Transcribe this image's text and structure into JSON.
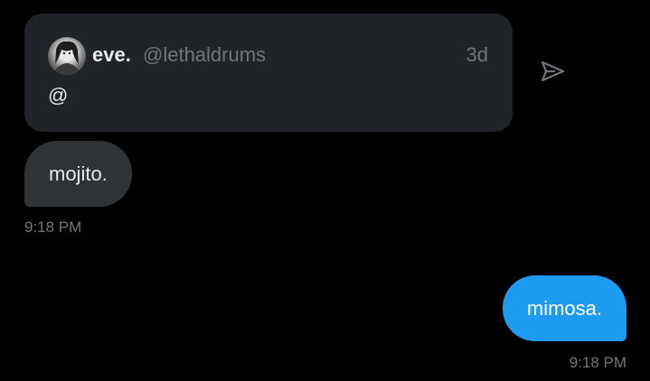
{
  "quoted_post": {
    "author_name": "eve.",
    "author_handle": "@lethaldrums",
    "age": "3d",
    "text": "@",
    "avatar_icon": "user-avatar"
  },
  "share_icon": "send-icon",
  "messages": [
    {
      "direction": "received",
      "text": "mojito.",
      "time": "9:18 PM"
    },
    {
      "direction": "sent",
      "text": "mimosa.",
      "time": "9:18 PM"
    }
  ],
  "colors": {
    "background": "#000000",
    "card": "#202327",
    "received_bubble": "#2f3336",
    "sent_bubble": "#1d9bf0",
    "muted_text": "#71767b",
    "primary_text": "#e7e9ea"
  }
}
